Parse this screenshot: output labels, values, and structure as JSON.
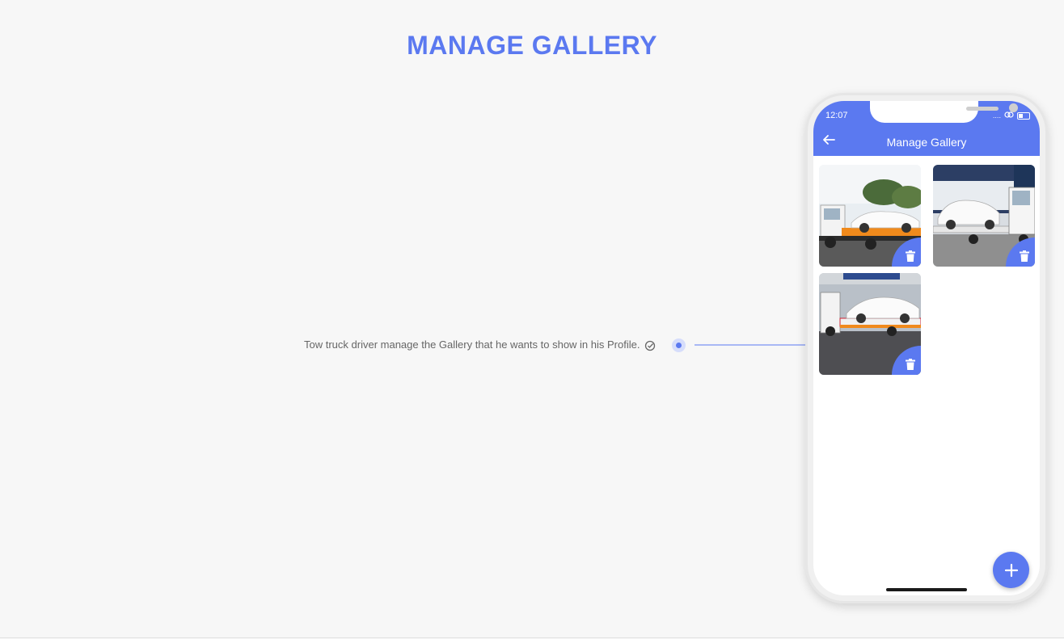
{
  "page": {
    "title": "MANAGE GALLERY"
  },
  "feature": {
    "text": "Tow truck driver manage the Gallery that he wants to show in his Profile."
  },
  "phone": {
    "status_time": "12:07",
    "header_title": "Manage Gallery",
    "gallery": [
      {
        "alt": "tow truck with white sedan"
      },
      {
        "alt": "tow truck with white hatchback"
      },
      {
        "alt": "tow truck with white SUV"
      }
    ]
  },
  "colors": {
    "accent": "#5b79f0",
    "background": "#f7f7f7"
  },
  "icons": [
    "check-circle-icon",
    "back-arrow-icon",
    "trash-icon",
    "plus-icon",
    "location-arrow-icon",
    "battery-icon"
  ]
}
